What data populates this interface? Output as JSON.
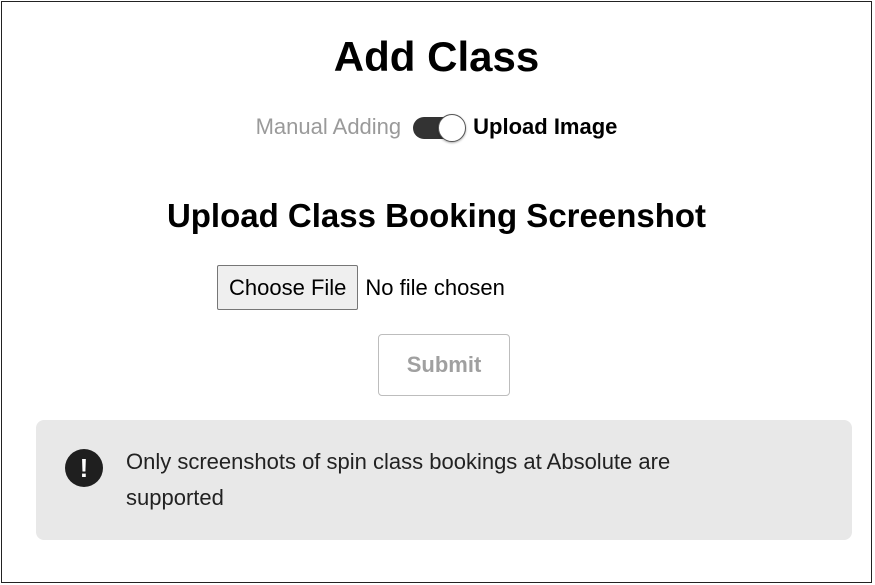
{
  "page": {
    "title": "Add Class"
  },
  "mode_toggle": {
    "left_label": "Manual Adding",
    "right_label": "Upload Image",
    "selected": "Upload Image"
  },
  "upload_section": {
    "heading": "Upload Class Booking Screenshot",
    "choose_file_label": "Choose File",
    "file_status": "No file chosen",
    "submit_label": "Submit"
  },
  "notice": {
    "icon": "exclamation-circle-icon",
    "icon_glyph": "!",
    "text": "Only screenshots of spin class bookings at Absolute are supported"
  }
}
